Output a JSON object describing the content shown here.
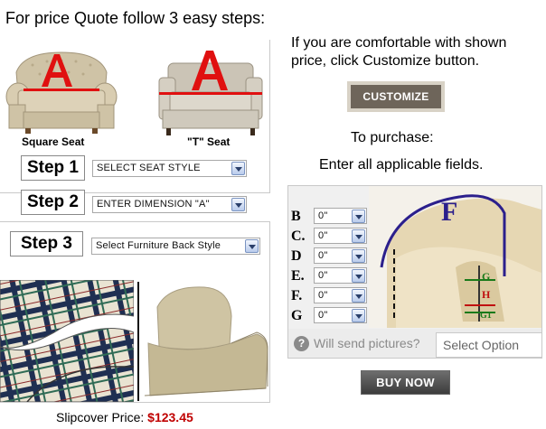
{
  "intro": "For price Quote follow 3 easy steps:",
  "seat_styles": {
    "square_caption": "Square Seat",
    "t_caption": "\"T\" Seat",
    "marker": "A"
  },
  "steps": [
    {
      "label": "Step 1",
      "select": "SELECT SEAT STYLE"
    },
    {
      "label": "Step 2",
      "select": "ENTER DIMENSION \"A\""
    },
    {
      "label": "Step 3",
      "select": "Select Furniture Back Style"
    }
  ],
  "info": {
    "comfortable_text": "If you are comfortable with shown price, click Customize button.",
    "customize_label": "CUSTOMIZE",
    "purchase_text": "To purchase:",
    "enter_fields_text": "Enter all applicable fields."
  },
  "fields": [
    {
      "label": "B",
      "value": "0\""
    },
    {
      "label": "C.",
      "value": "0\""
    },
    {
      "label": "D",
      "value": "0\""
    },
    {
      "label": "E.",
      "value": "0\""
    },
    {
      "label": "F.",
      "value": "0\""
    },
    {
      "label": "G",
      "value": "0\""
    }
  ],
  "diagram": {
    "label_f": "F",
    "label_g": "G",
    "label_h": "H",
    "label_g1": "G1"
  },
  "pictures": {
    "icon": "question-icon",
    "label": "Will send pictures?",
    "select_placeholder": "Select Option"
  },
  "buy_now_label": "BUY NOW",
  "price": {
    "label": "Slipcover Price:",
    "value": "$123.45"
  },
  "colors": {
    "customize_bg": "#6e655a",
    "price_red": "#c00000",
    "marker_red": "#e01010",
    "diagram_blue": "#2b1f8c"
  }
}
